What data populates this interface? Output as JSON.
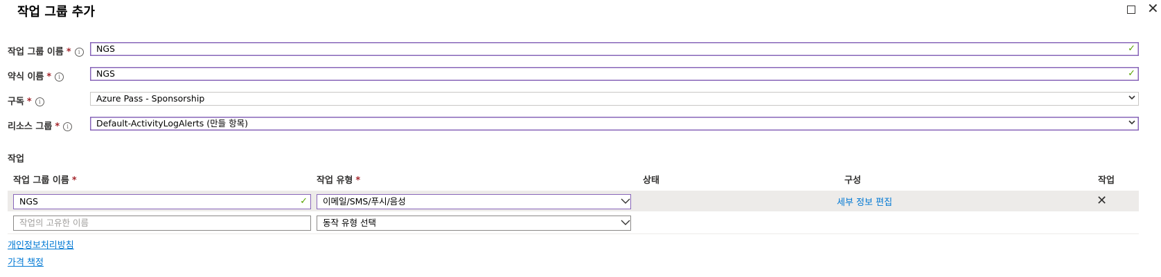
{
  "window": {
    "title": "작업 그룹 추가",
    "maximize_icon": "square-maximize-icon",
    "close_icon": "close-icon"
  },
  "form": {
    "action_group_name": {
      "label": "작업 그룹 이름",
      "required": "*",
      "value": "NGS"
    },
    "short_name": {
      "label": "약식 이름",
      "required": "*",
      "value": "NGS"
    },
    "subscription": {
      "label": "구독",
      "required": "*",
      "value": "Azure Pass - Sponsorship"
    },
    "resource_group": {
      "label": "리소스 그룹",
      "required": "*",
      "value": "Default-ActivityLogAlerts (만들 항목)"
    }
  },
  "actions": {
    "section_title": "작업",
    "headers": {
      "name": "작업 그룹 이름",
      "name_required": "*",
      "type": "작업 유형",
      "type_required": "*",
      "status": "상태",
      "config": "구성",
      "action": "작업"
    },
    "rows": [
      {
        "name": "NGS",
        "type": "이메일/SMS/푸시/음성",
        "status": "",
        "config_link": "세부 정보 편집",
        "delete_icon": "close-icon"
      }
    ],
    "new_row": {
      "name_placeholder": "작업의 고유한 이름",
      "type_placeholder": "동작 유형 선택"
    }
  },
  "footer": {
    "privacy_link": "개인정보처리방침",
    "pricing_link": "가격 책정"
  },
  "colors": {
    "accent": "#8764b8",
    "link": "#0078d4",
    "required": "#a4262c",
    "valid": "#57a300"
  }
}
